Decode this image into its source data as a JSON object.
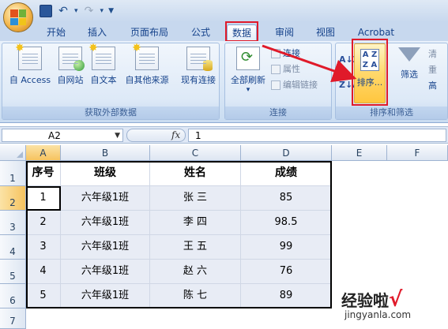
{
  "quick_access": {
    "save_icon": "save-icon",
    "undo_icon": "undo-icon",
    "redo_icon": "redo-icon"
  },
  "tabs": [
    "开始",
    "插入",
    "页面布局",
    "公式",
    "数据",
    "审阅",
    "视图",
    "Acrobat"
  ],
  "active_tab": "数据",
  "ribbon": {
    "external_data": {
      "label": "获取外部数据",
      "buttons": [
        "自 Access",
        "自网站",
        "自文本",
        "自其他来源",
        "现有连接"
      ]
    },
    "connections": {
      "label": "连接",
      "refresh_all": "全部刷新",
      "items": [
        "连接",
        "属性",
        "编辑链接"
      ]
    },
    "sort_filter": {
      "label": "排序和筛选",
      "sort": "排序...",
      "filter": "筛选",
      "az_label_top": "A Z",
      "az_label_bottom": "Z A",
      "sort_asc_small": "A↓Z",
      "sort_desc_small": "Z↓A",
      "right_items": [
        "清",
        "重",
        "高"
      ]
    }
  },
  "formula_bar": {
    "name_box": "A2",
    "fx": "fx",
    "value": "1"
  },
  "columns": [
    "A",
    "B",
    "C",
    "D",
    "E",
    "F"
  ],
  "rows": [
    "1",
    "2",
    "3",
    "4",
    "5",
    "6",
    "7"
  ],
  "table": {
    "headers": [
      "序号",
      "班级",
      "姓名",
      "成绩"
    ],
    "rows": [
      [
        "1",
        "六年级1班",
        "张  三",
        "85"
      ],
      [
        "2",
        "六年级1班",
        "李  四",
        "98.5"
      ],
      [
        "3",
        "六年级1班",
        "王  五",
        "99"
      ],
      [
        "4",
        "六年级1班",
        "赵  六",
        "76"
      ],
      [
        "5",
        "六年级1班",
        "陈  七",
        "89"
      ]
    ]
  },
  "watermark": {
    "text": "经验啦",
    "check": "√",
    "sub": "jingyanla.com"
  },
  "colors": {
    "highlight_red": "#e01a2a",
    "ribbon_blue": "#c7d8ee",
    "sort_gold": "#ffd86b"
  }
}
